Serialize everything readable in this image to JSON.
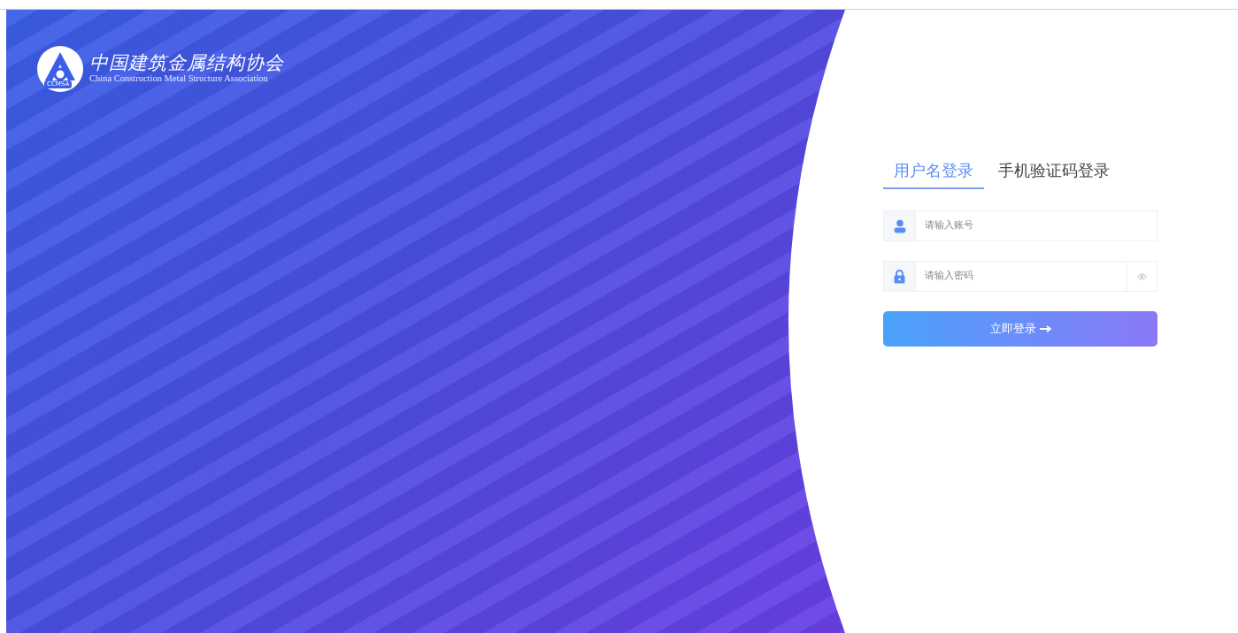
{
  "brand": {
    "abbreviation": "CCMSA",
    "name": "中国建筑金属结构协会",
    "name_en": "China Construction Metal Structure Association"
  },
  "tabs": [
    {
      "label": "用户名登录",
      "selected": true
    },
    {
      "label": "手机验证码登录",
      "selected": false
    }
  ],
  "fields": [
    {
      "kind": "username",
      "placeholder": "请输入账号"
    },
    {
      "kind": "password",
      "placeholder": "请输入密码"
    }
  ],
  "submit": {
    "label": "立即登录"
  }
}
